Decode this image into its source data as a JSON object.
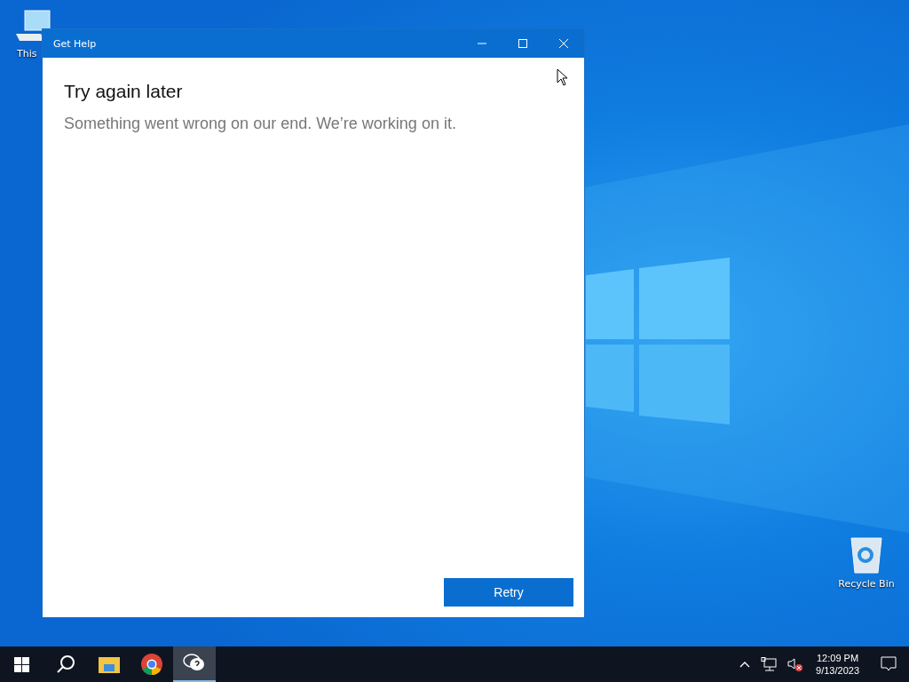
{
  "desktop_icons": [
    {
      "kind": "computer",
      "label": "This"
    },
    {
      "kind": "bin",
      "label": "Recycle Bin"
    }
  ],
  "window": {
    "title": "Get Help",
    "heading": "Try again later",
    "message": "Something went wrong on our end. We’re working on it.",
    "button": "Retry"
  },
  "taskbar": {
    "apps": [
      {
        "kind": "folder",
        "selected": false
      },
      {
        "kind": "browser",
        "selected": false
      },
      {
        "kind": "help",
        "selected": true
      }
    ],
    "time": "12:09 PM",
    "date": "9/13/2023",
    "volume_muted": true
  }
}
